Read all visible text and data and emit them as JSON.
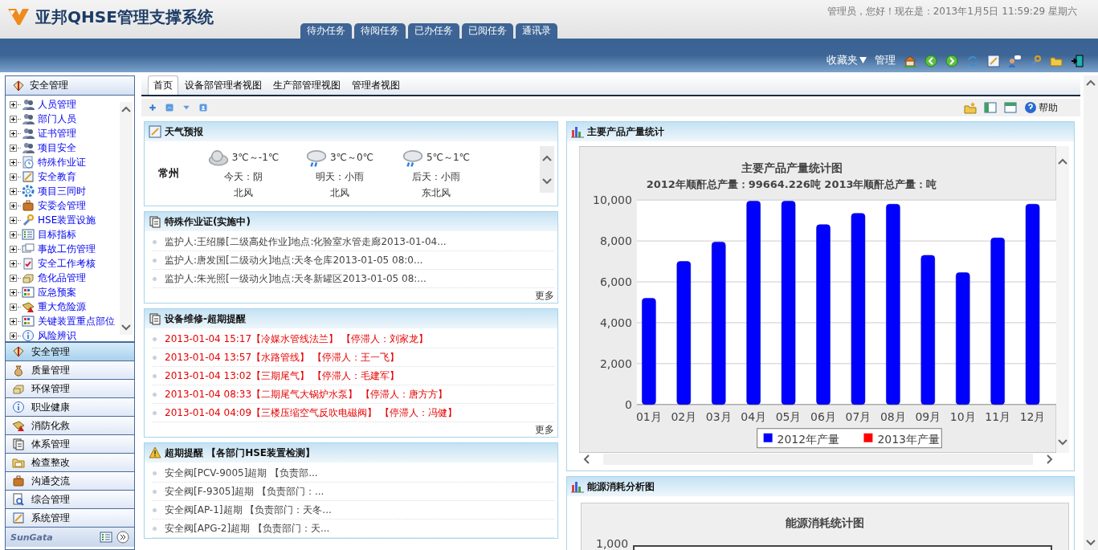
{
  "app": {
    "title": "亚邦QHSE管理支撑系统",
    "greeting": "管理员，您好！现在是：2013年1月5日  11:59:29 星期六"
  },
  "nav_tabs": [
    {
      "label": "待办任务"
    },
    {
      "label": "待阅任务"
    },
    {
      "label": "已办任务"
    },
    {
      "label": "已阅任务"
    },
    {
      "label": "通讯录"
    }
  ],
  "toolbar": {
    "favorites": "收藏夹",
    "manage": "管理"
  },
  "sidebar": {
    "section": "安全管理",
    "tree": [
      {
        "label": "人员管理",
        "expanded": false
      },
      {
        "label": "部门人员",
        "expanded": false
      },
      {
        "label": "证书管理",
        "expanded": false
      },
      {
        "label": "项目安全",
        "expanded": false
      },
      {
        "label": "特殊作业证",
        "expanded": false
      },
      {
        "label": "安全教育",
        "expanded": false
      },
      {
        "label": "项目三同时",
        "expanded": false
      },
      {
        "label": "安委会管理",
        "expanded": false
      },
      {
        "label": "HSE装置设施",
        "expanded": false
      },
      {
        "label": "目标指标",
        "expanded": false
      },
      {
        "label": "事故工伤管理",
        "expanded": false
      },
      {
        "label": "安全工作考核",
        "expanded": false
      },
      {
        "label": "危化品管理",
        "expanded": false
      },
      {
        "label": "应急预案",
        "expanded": false
      },
      {
        "label": "重大危险源",
        "expanded": false
      },
      {
        "label": "关键装置重点部位",
        "expanded": false
      },
      {
        "label": "风险辨识",
        "expanded": false
      }
    ],
    "modules": [
      {
        "label": "安全管理",
        "selected": true
      },
      {
        "label": "质量管理",
        "selected": false
      },
      {
        "label": "环保管理",
        "selected": false
      },
      {
        "label": "职业健康",
        "selected": false
      },
      {
        "label": "消防化救",
        "selected": false
      },
      {
        "label": "体系管理",
        "selected": false
      },
      {
        "label": "检查整改",
        "selected": false
      },
      {
        "label": "沟通交流",
        "selected": false
      },
      {
        "label": "综合管理",
        "selected": false
      },
      {
        "label": "系统管理",
        "selected": false
      }
    ],
    "logo": "SunGata"
  },
  "view_tabs": [
    {
      "label": "首页",
      "selected": true
    },
    {
      "label": "设备部管理者视图",
      "selected": false
    },
    {
      "label": "生产部管理视图",
      "selected": false
    },
    {
      "label": "管理者视图",
      "selected": false
    }
  ],
  "help": "帮助",
  "weather": {
    "title": "天气预报",
    "city": "常州",
    "days": [
      {
        "temp": "3℃～-1℃",
        "day": "今天：阴",
        "wind": "北风",
        "kind": "cloudy"
      },
      {
        "temp": "3℃～0℃",
        "day": "明天：小雨",
        "wind": "北风",
        "kind": "rain"
      },
      {
        "temp": "5℃～1℃",
        "day": "后天：小雨",
        "wind": "东北风",
        "kind": "rain"
      }
    ]
  },
  "permits": {
    "title": "特殊作业证(实施中)",
    "items": [
      "监护人:王绍滕[二级高处作业]地点:化验室水管走廊2013-01-04...",
      "监护人:唐发国[二级动火]地点:天冬仓库2013-01-05 08:0...",
      "监护人:朱光照[一级动火]地点:天冬新罐区2013-01-05 08:..."
    ],
    "more": "更多"
  },
  "maintenance": {
    "title": "设备维修-超期提醒",
    "items": [
      "2013-01-04 15:17【冷媒水管线法兰】 【停滞人：刘家龙】",
      "2013-01-04 13:57【水路管线】 【停滞人：王一飞】",
      "2013-01-04 13:02【三期尾气】 【停滞人：毛建军】",
      "2013-01-04 08:33【二期尾气大锅炉水泵】 【停滞人：唐方方】",
      "2013-01-04 04:09【三楼压缩空气反吹电磁阀】 【停滞人：冯健】"
    ],
    "more": "更多"
  },
  "overdue": {
    "title": "超期提醒 【各部门HSE装置检测】",
    "items": [
      "安全阀[PCV-9005]超期 【负责部...",
      "安全阀[F-9305]超期 【负责部门：...",
      "安全阀[AP-1]超期 【负责部门：天冬...",
      "安全阀[APG-2]超期 【负责部门：天..."
    ]
  },
  "production": {
    "title": "主要产品产量统计",
    "subtitle": "2012年顺酐总产量：99664.226吨 2013年顺酐总产量：吨",
    "chart_data": {
      "type": "bar",
      "title": "主要产品产量统计图",
      "categories": [
        "01月",
        "02月",
        "03月",
        "04月",
        "05月",
        "06月",
        "07月",
        "08月",
        "09月",
        "10月",
        "11月",
        "12月"
      ],
      "series": [
        {
          "name": "2012年产量",
          "color": "#0000ff",
          "values": [
            5200,
            7000,
            7950,
            9950,
            9950,
            8800,
            9350,
            9800,
            7300,
            6450,
            8150,
            9800
          ]
        },
        {
          "name": "2013年产量",
          "color": "#ff0000",
          "values": [
            null,
            null,
            null,
            null,
            null,
            null,
            null,
            null,
            null,
            null,
            null,
            null
          ]
        }
      ],
      "grid": true,
      "ylim": [
        0,
        10000
      ],
      "yticks": [
        {
          "value": 0,
          "label": "0"
        },
        {
          "value": 2000,
          "label": "2,000"
        },
        {
          "value": 4000,
          "label": "4,000"
        },
        {
          "value": 6000,
          "label": "6,000"
        },
        {
          "value": 8000,
          "label": "8,000"
        },
        {
          "value": 10000,
          "label": "10,000"
        }
      ]
    }
  },
  "energy": {
    "title": "能源消耗分析图",
    "chart_title": "能源消耗统计图",
    "top_tick": "1,000"
  }
}
